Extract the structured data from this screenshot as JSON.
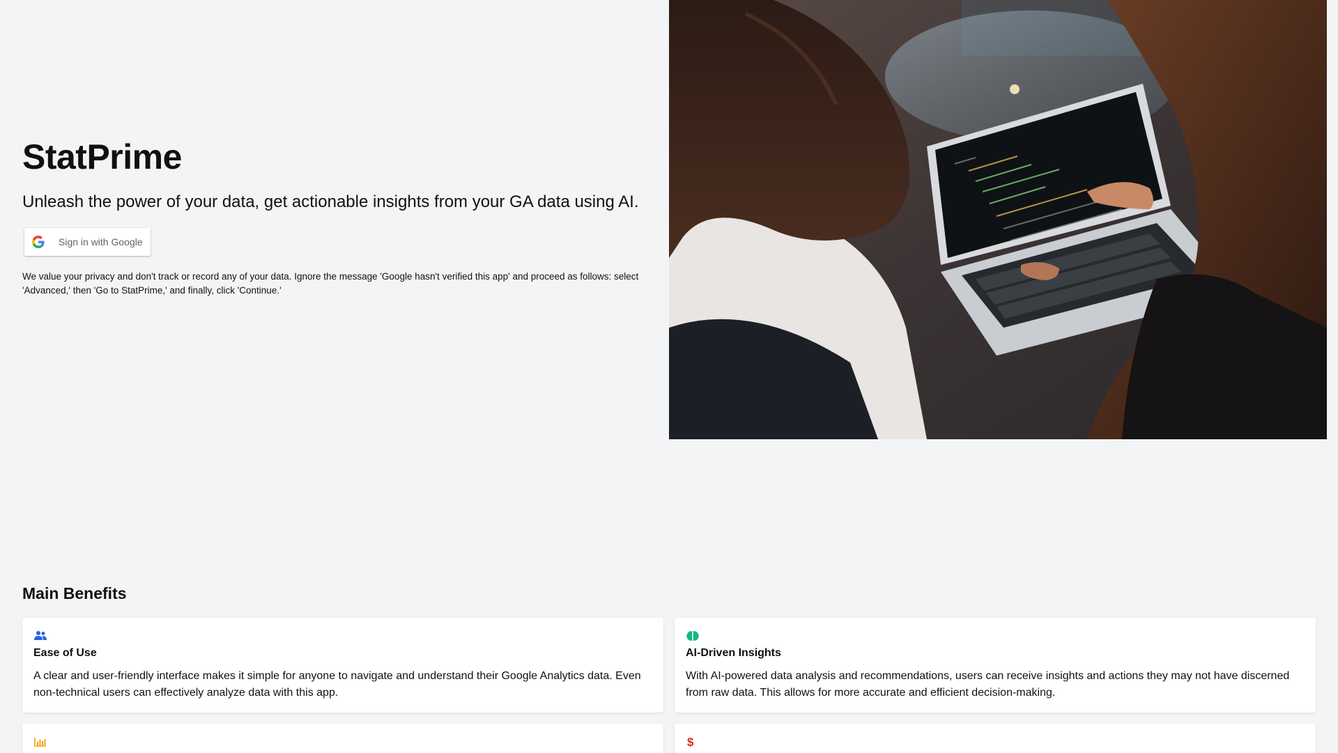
{
  "app_title": "StatPrime",
  "tagline": "Unleash the power of your data, get actionable insights from your GA data using AI.",
  "signin_button_label": "Sign in with Google",
  "privacy_note": "We value your privacy and don't track or record any of your data. Ignore the message 'Google hasn't verified this app' and proceed as follows: select 'Advanced,' then 'Go to StatPrime,' and finally, click 'Continue.'",
  "benefits": {
    "heading": "Main Benefits",
    "items": [
      {
        "icon": "users-icon",
        "icon_color": "#2563eb",
        "title": "Ease of Use",
        "description": "A clear and user-friendly interface makes it simple for anyone to navigate and understand their Google Analytics data. Even non-technical users can effectively analyze data with this app."
      },
      {
        "icon": "brain-icon",
        "icon_color": "#10b981",
        "title": "AI-Driven Insights",
        "description": "With AI-powered data analysis and recommendations, users can receive insights and actions they may not have discerned from raw data. This allows for more accurate and efficient decision-making."
      },
      {
        "icon": "bar-chart-icon",
        "icon_color": "#f59e0b",
        "title": "",
        "description": ""
      },
      {
        "icon": "dollar-icon",
        "icon_color": "#dc2626",
        "title": "",
        "description": ""
      }
    ]
  }
}
